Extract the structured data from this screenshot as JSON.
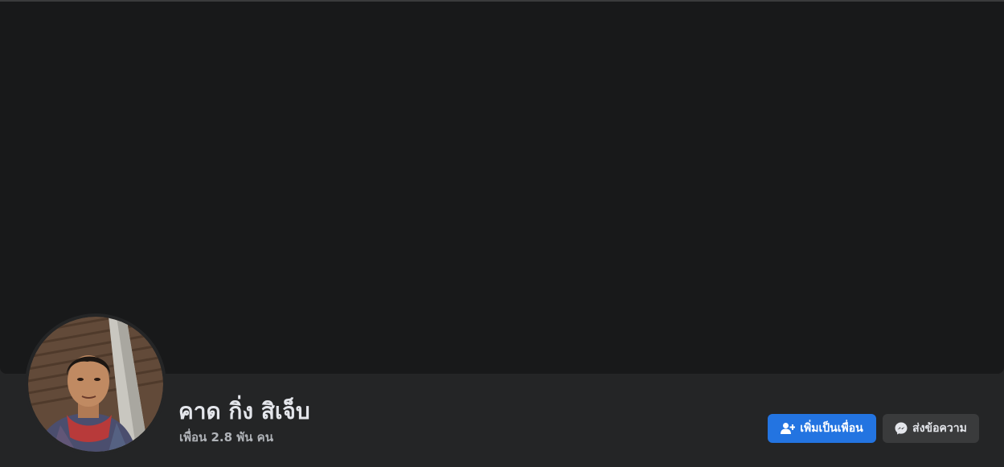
{
  "profile": {
    "name": "คาด กิ่ง สิเจ็บ",
    "friends_count": "เพื่อน 2.8 พัน คน"
  },
  "actions": {
    "add_friend_label": "เพิ่มเป็นเพื่อน",
    "message_label": "ส่งข้อความ"
  },
  "colors": {
    "page_bg": "#242526",
    "cover_bg": "#18191a",
    "primary_button": "#2374e1",
    "secondary_button": "#3a3b3c",
    "name_text": "#e4e6eb",
    "secondary_text": "#b0b3b8"
  },
  "icons": {
    "add_friend": "add-friend-icon",
    "messenger": "messenger-icon"
  }
}
